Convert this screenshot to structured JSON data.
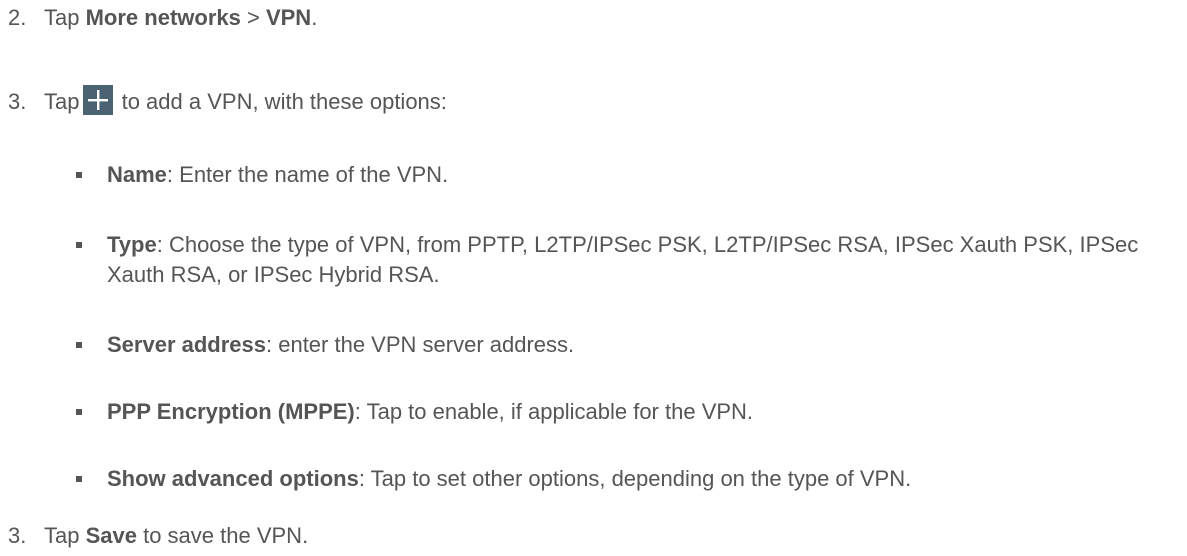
{
  "steps": [
    {
      "num": "2.",
      "pre": "Tap ",
      "b1": "More networks",
      "mid": " > ",
      "b2": "VPN",
      "post": "."
    },
    {
      "num": "3.",
      "pre": "Tap",
      "post": " to add a VPN, with these options:",
      "icon": "plus-icon"
    },
    {
      "num": "3.",
      "pre": "Tap ",
      "b1": "Save",
      "post": " to save the VPN."
    }
  ],
  "options": [
    {
      "label": "Name",
      "text": ": Enter the name of the VPN."
    },
    {
      "label": "Type",
      "text": ": Choose the type of VPN, from PPTP, L2TP/IPSec PSK, L2TP/IPSec RSA, IPSec Xauth PSK, IPSec Xauth RSA, or IPSec Hybrid RSA."
    },
    {
      "label": "Server address",
      "text": ": enter the VPN server address."
    },
    {
      "label": "PPP Encryption (MPPE)",
      "text": ": Tap to enable, if applicable for the VPN."
    },
    {
      "label": "Show advanced options",
      "text": ": Tap to set other options, depending on the type of VPN."
    }
  ],
  "colors": {
    "text": "#555555",
    "icon_bg": "#4a6272",
    "icon_fg": "#ffffff"
  }
}
